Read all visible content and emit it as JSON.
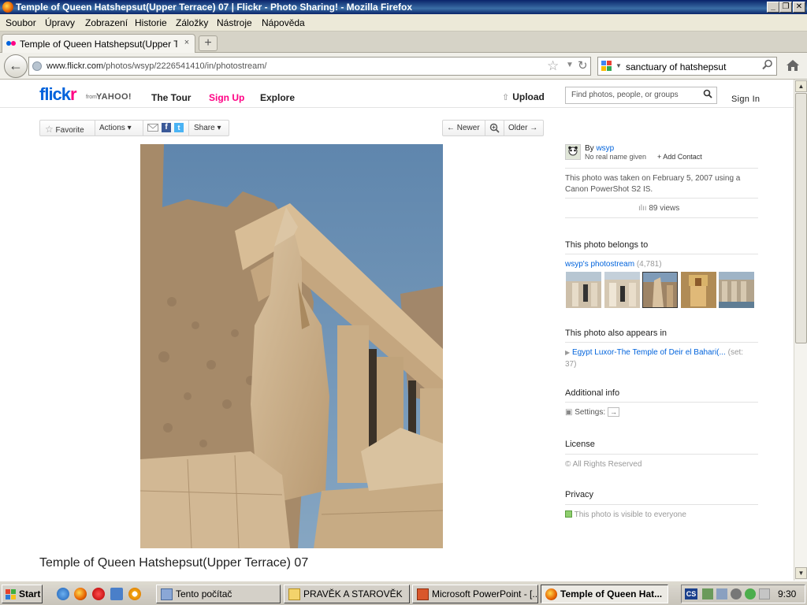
{
  "window": {
    "title": "Temple of Queen Hatshepsut(Upper Terrace) 07 | Flickr - Photo Sharing! - Mozilla Firefox",
    "min_glyph": "_",
    "max_glyph": "❐",
    "close_glyph": "✕"
  },
  "menubar": [
    "Soubor",
    "Úpravy",
    "Zobrazení",
    "Historie",
    "Záložky",
    "Nástroje",
    "Nápověda"
  ],
  "tabs": [
    {
      "label": "Temple of Queen Hatshepsut(Upper Terrace...",
      "close": "×"
    }
  ],
  "newtab_glyph": "+",
  "nav": {
    "back_glyph": "←",
    "url_host": "www.flickr.com",
    "url_path": "/photos/wsyp/2226541410/in/photostream/",
    "star_glyph": "☆",
    "reload_glyph": "↻",
    "search_query": "sanctuary of hatshepsut",
    "search_glyph": "⚲"
  },
  "flickr": {
    "logo_a": "flick",
    "logo_b": "r",
    "from": "from",
    "yahoo": "YAHOO!",
    "nav": [
      "The Tour",
      "Sign Up",
      "Explore"
    ],
    "accent": "#ff0084",
    "blue": "#0063dc",
    "upload": "Upload",
    "search_placeholder": "Find photos, people, or groups",
    "signin": "Sign In"
  },
  "toolbar": {
    "favorite": "Favorite",
    "actions": "Actions ▾",
    "share": "Share ▾",
    "newer": "← Newer",
    "older": "Older →"
  },
  "photo": {
    "title": "Temple of Queen Hatshepsut(Upper Terrace) 07"
  },
  "sidebar": {
    "by": "By",
    "owner": "wsyp",
    "realname": "No real name given",
    "add_contact": "+ Add Contact",
    "taken_line1": "This photo was taken on February 5, 2007 using a",
    "taken_line2": "Canon PowerShot S2 IS.",
    "views": "89 views",
    "belongs_head": "This photo belongs to",
    "stream_link": "wsyp's photostream",
    "stream_count": "(4,781)",
    "appears_head": "This photo also appears in",
    "set_link": "Egypt Luxor-The Temple of Deir el Bahari(...",
    "set_suffix": "(set:",
    "set_count": "37)",
    "additional_head": "Additional info",
    "settings": "Settings:",
    "settings_btn": "→",
    "license_head": "License",
    "license": "All Rights Reserved",
    "privacy_head": "Privacy",
    "privacy": "This photo is visible to everyone"
  },
  "taskbar": {
    "start": "Start",
    "tasks": [
      {
        "label": "Tento počítač",
        "active": false
      },
      {
        "label": "PRAVĚK A STAROVĚK",
        "active": false
      },
      {
        "label": "Microsoft PowerPoint - [...",
        "active": false
      },
      {
        "label": "Temple of Queen Hat...",
        "active": true
      }
    ],
    "clock": "9:30",
    "lang": "CS"
  }
}
